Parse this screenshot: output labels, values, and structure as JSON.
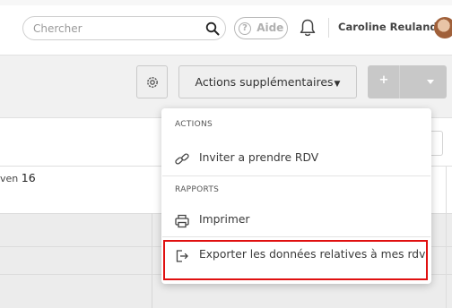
{
  "header": {
    "search_placeholder": "Chercher",
    "help_label": "Aide",
    "help_icon_glyph": "?",
    "user_name": "Caroline Reuland"
  },
  "toolbar": {
    "actions_label": "Actions supplémentaires",
    "add_label": "+"
  },
  "calendar": {
    "day_name": "ven",
    "day_number": "16"
  },
  "dropdown": {
    "sections": [
      {
        "title": "ACTIONS",
        "items": [
          {
            "label": "Inviter a prendre RDV",
            "icon": "link-icon"
          }
        ]
      },
      {
        "title": "RAPPORTS",
        "items": [
          {
            "label": "Imprimer",
            "icon": "printer-icon"
          },
          {
            "label": "Exporter les données relatives à mes rdv",
            "icon": "export-icon"
          }
        ]
      }
    ]
  },
  "colors": {
    "highlight": "#e01010",
    "add_button": "#c8c8c8"
  }
}
